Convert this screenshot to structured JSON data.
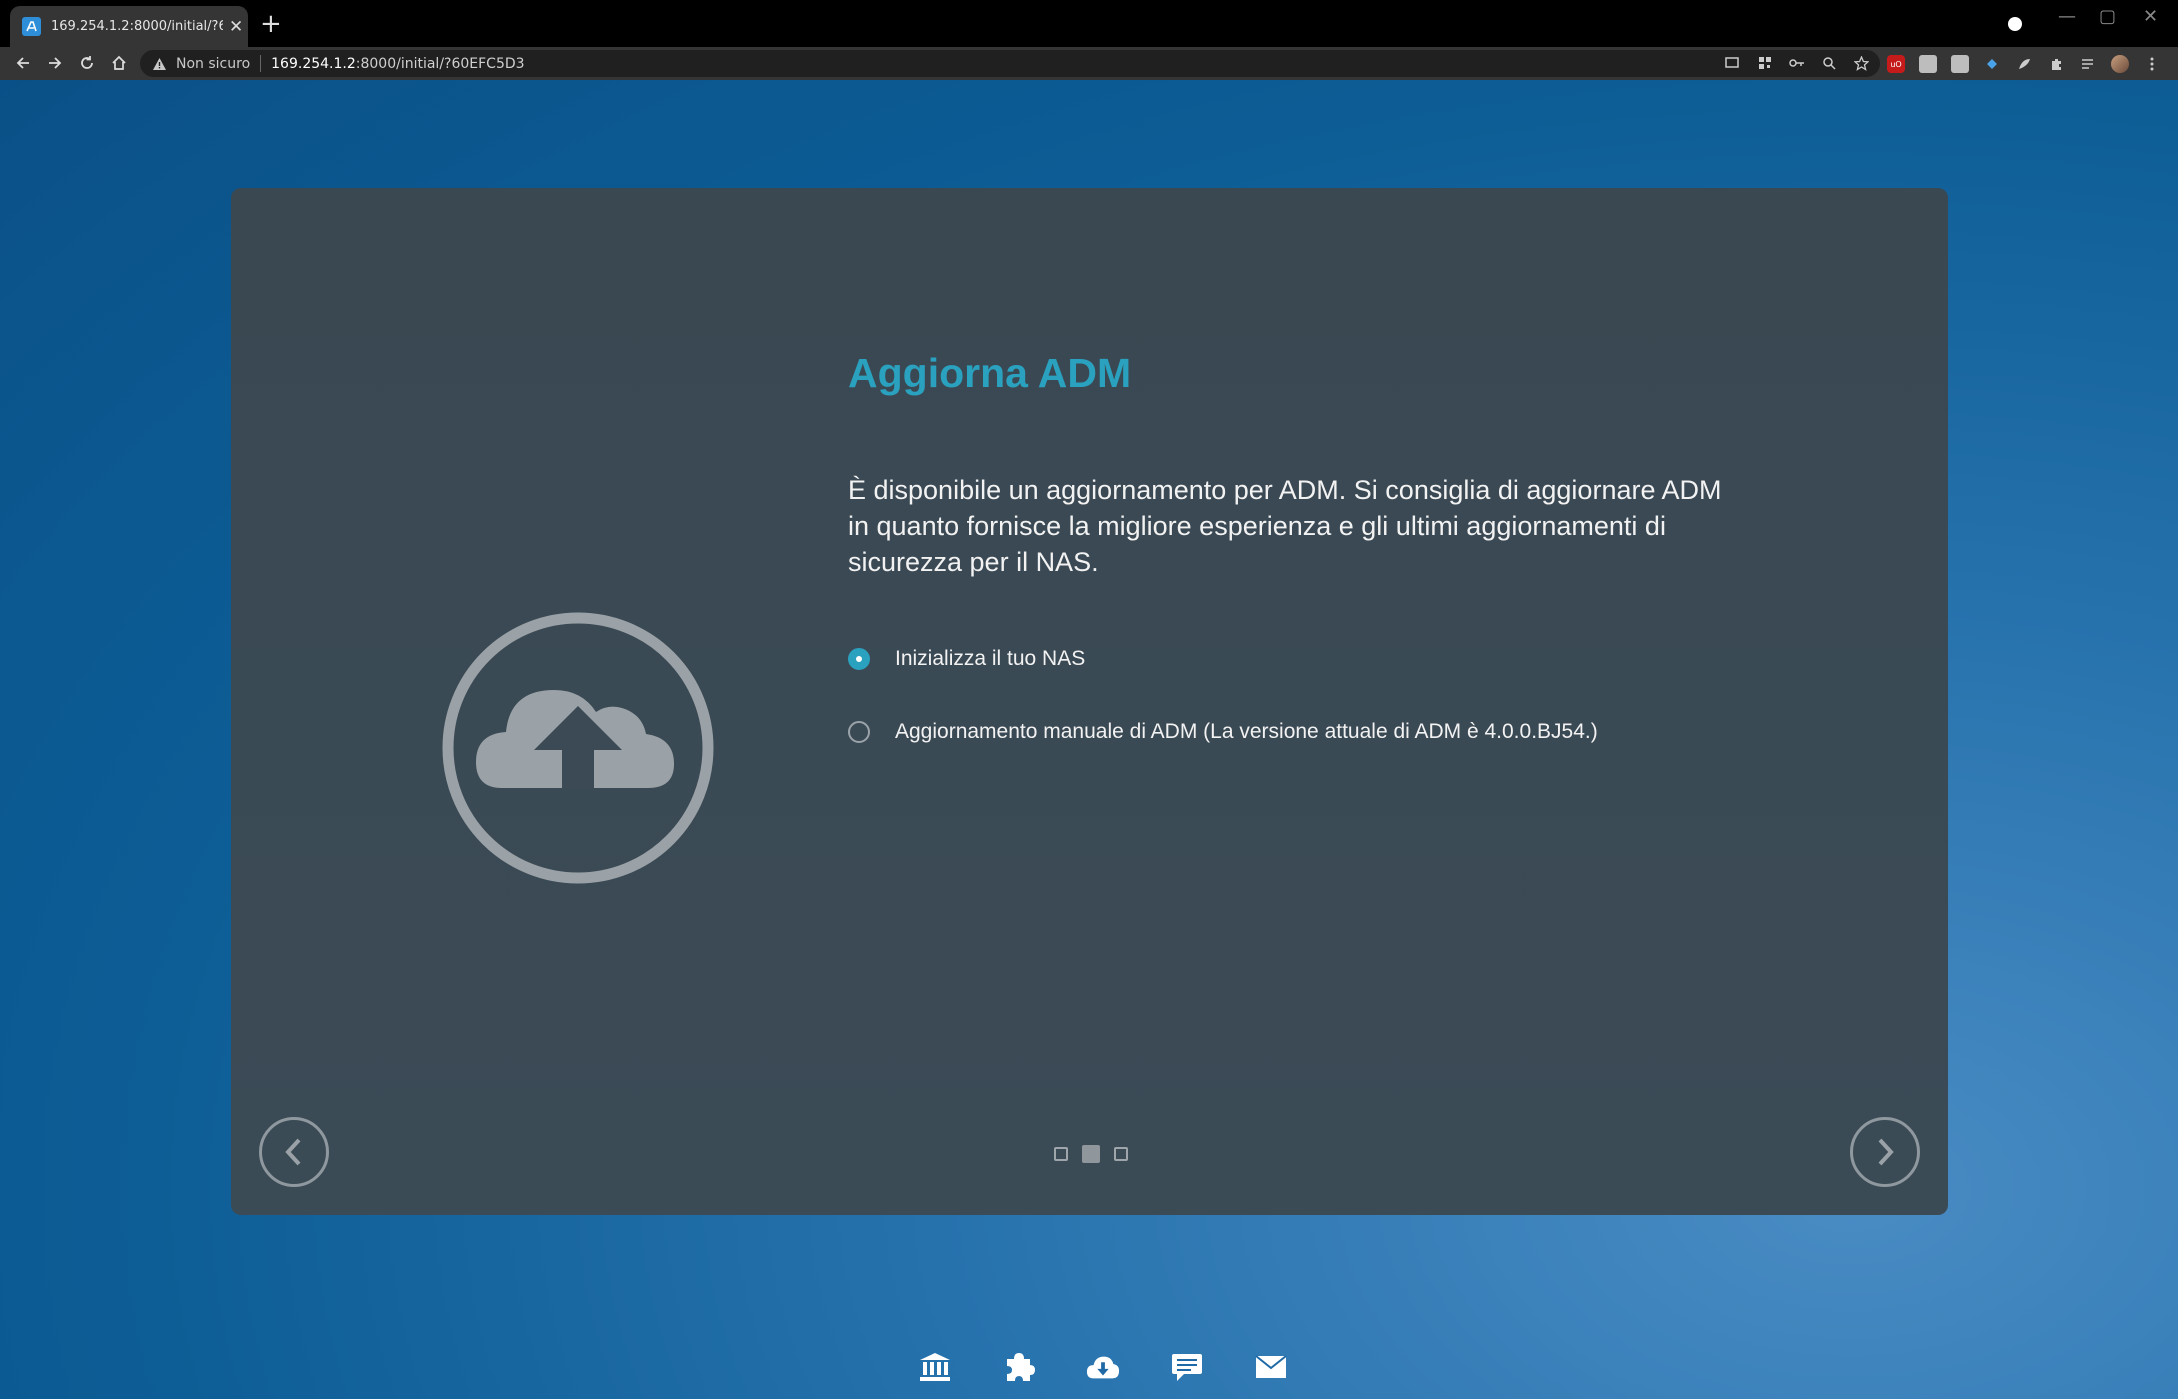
{
  "browser": {
    "tab_title": "169.254.1.2:8000/initial/?60EFC5D3",
    "tab_close": "✕",
    "new_tab": "+",
    "security_label": "Non sicuro",
    "url_host": "169.254.1.2",
    "url_rest": ":8000/initial/?60EFC5D3"
  },
  "wizard": {
    "title": "Aggiorna ADM",
    "description": "È disponibile un aggiornamento per ADM. Si consiglia di aggiornare ADM in quanto fornisce la migliore esperienza e gli ultimi aggiornamenti di sicurezza per il NAS.",
    "options": [
      {
        "label": "Inizializza il tuo NAS",
        "selected": true
      },
      {
        "label": "Aggiornamento manuale di ADM (La versione attuale di ADM è 4.0.0.BJ54.)",
        "selected": false
      }
    ],
    "page_indicator": {
      "current": 2,
      "total": 3
    },
    "accent_color": "#2aa1bf"
  },
  "dock": {
    "icons": [
      "bank-icon",
      "puzzle-icon",
      "cloud-download-icon",
      "chat-icon",
      "mail-icon"
    ]
  }
}
